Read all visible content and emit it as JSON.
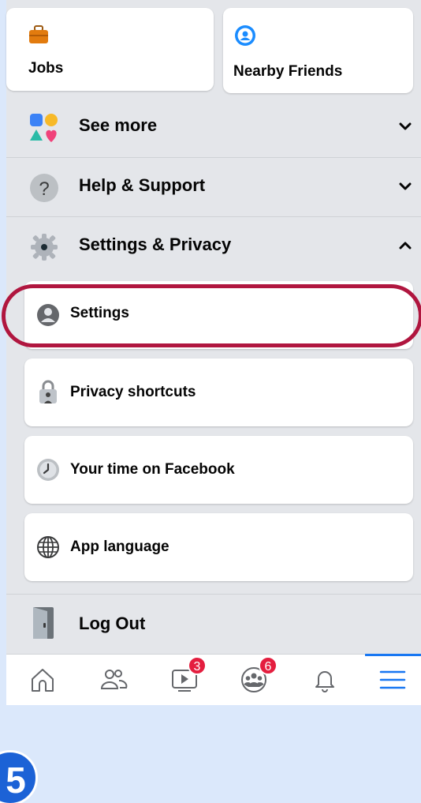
{
  "shortcuts": {
    "jobs": {
      "label": "Jobs",
      "icon": "briefcase-icon"
    },
    "nearby": {
      "label": "Nearby Friends",
      "icon": "nearby-friends-icon"
    }
  },
  "menu": {
    "see_more": {
      "label": "See more",
      "icon": "shapes-icon",
      "chevron": "chevron-down-icon"
    },
    "help": {
      "label": "Help & Support",
      "icon": "question-icon",
      "chevron": "chevron-down-icon"
    },
    "settings_privacy": {
      "label": "Settings & Privacy",
      "icon": "gear-icon",
      "chevron": "chevron-up-icon"
    },
    "logout": {
      "label": "Log Out",
      "icon": "door-icon"
    }
  },
  "submenu": [
    {
      "label": "Settings",
      "icon": "profile-icon"
    },
    {
      "label": "Privacy shortcuts",
      "icon": "lock-icon"
    },
    {
      "label": "Your time on Facebook",
      "icon": "clock-icon"
    },
    {
      "label": "App language",
      "icon": "globe-icon"
    }
  ],
  "tabbar": {
    "tabs": [
      {
        "name": "home",
        "icon": "home-icon"
      },
      {
        "name": "friends",
        "icon": "friends-icon"
      },
      {
        "name": "watch",
        "icon": "video-icon",
        "badge": "3"
      },
      {
        "name": "groups",
        "icon": "groups-icon",
        "badge": "6"
      },
      {
        "name": "notifications",
        "icon": "bell-icon"
      },
      {
        "name": "menu",
        "icon": "hamburger-icon",
        "active": true
      }
    ]
  },
  "step": {
    "number": "5"
  },
  "colors": {
    "accent": "#1877f2",
    "highlight": "#b0163f",
    "badge": "#e41e3f",
    "backdrop": "#dbe8fb"
  }
}
